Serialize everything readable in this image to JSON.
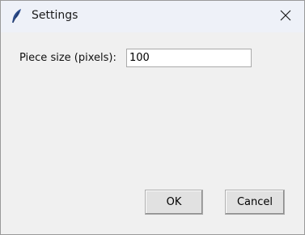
{
  "window": {
    "title": "Settings",
    "app_icon": "feather-icon",
    "close_icon": "close-icon"
  },
  "form": {
    "piece_size_label": "Piece size (pixels):",
    "piece_size_value": "100"
  },
  "buttons": {
    "ok_label": "OK",
    "cancel_label": "Cancel"
  },
  "colors": {
    "titlebar": "#eef1f8",
    "client": "#f0f0f0",
    "feather": "#2b4c8c"
  }
}
